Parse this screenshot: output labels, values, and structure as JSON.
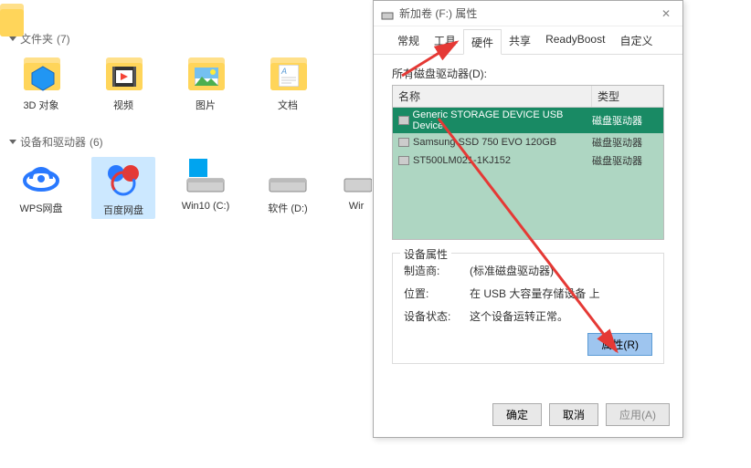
{
  "explorer": {
    "section1": {
      "title": "文件夹",
      "count": "(7)"
    },
    "section2": {
      "title": "设备和驱动器",
      "count": "(6)"
    },
    "folders": [
      {
        "label": "3D 对象"
      },
      {
        "label": "视频"
      },
      {
        "label": "图片"
      },
      {
        "label": "文档"
      }
    ],
    "drives": [
      {
        "label": "WPS网盘"
      },
      {
        "label": "百度网盘"
      },
      {
        "label": "Win10 (C:)"
      },
      {
        "label": "软件 (D:)"
      },
      {
        "label": "Wir"
      }
    ]
  },
  "dialog": {
    "icon": "drive-icon",
    "title": "新加卷 (F:) 属性",
    "tabs": [
      "常规",
      "工具",
      "硬件",
      "共享",
      "ReadyBoost",
      "自定义"
    ],
    "list_title": "所有磁盘驱动器(D):",
    "header": {
      "name": "名称",
      "type": "类型"
    },
    "rows": [
      {
        "name": "Generic STORAGE DEVICE USB Device",
        "type": "磁盘驱动器",
        "selected": true
      },
      {
        "name": "Samsung SSD 750 EVO 120GB",
        "type": "磁盘驱动器",
        "selected": false
      },
      {
        "name": "ST500LM021-1KJ152",
        "type": "磁盘驱动器",
        "selected": false
      }
    ],
    "props_title": "设备属性",
    "props": {
      "mfr_k": "制造商:",
      "mfr_v": "(标准磁盘驱动器)",
      "loc_k": "位置:",
      "loc_v": "在 USB 大容量存储设备 上",
      "stat_k": "设备状态:",
      "stat_v": "这个设备运转正常。"
    },
    "btn_props": "属性(R)",
    "btn_ok": "确定",
    "btn_cancel": "取消",
    "btn_apply": "应用(A)"
  }
}
